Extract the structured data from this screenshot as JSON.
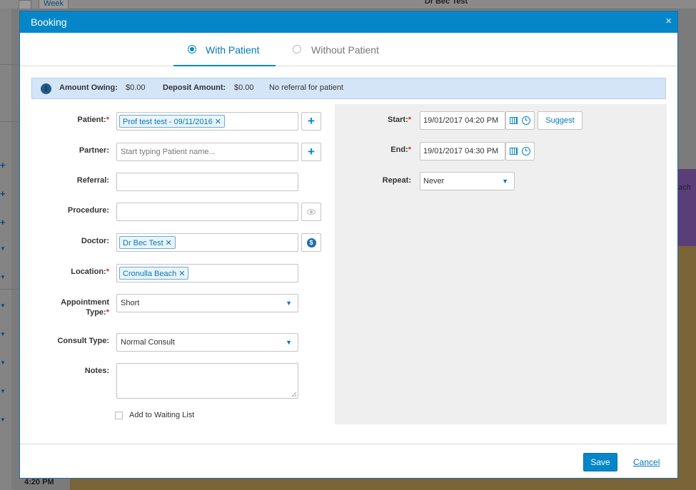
{
  "background": {
    "view_button": "Week",
    "doctor_column": "Dr Bec Test",
    "event_fragment": "ach",
    "time_label": "4:20 PM"
  },
  "modal": {
    "title": "Booking",
    "close_glyph": "×"
  },
  "tabs": {
    "with_patient": "With Patient",
    "without_patient": "Without Patient",
    "selected": "With Patient"
  },
  "alert": {
    "info_glyph": "i",
    "amount_owing_label": "Amount Owing:",
    "amount_owing_value": "$0.00",
    "deposit_label": "Deposit Amount:",
    "deposit_value": "$0.00",
    "referral_note": "No referral for patient"
  },
  "form": {
    "required_mark": "*",
    "patient_label": "Patient:",
    "patient_tag": "Prof test test - 09/11/2016",
    "partner_label": "Partner:",
    "partner_placeholder": "Start typing Patient name...",
    "referral_label": "Referral:",
    "referral_value": "",
    "procedure_label": "Procedure:",
    "procedure_value": "",
    "doctor_label": "Doctor:",
    "doctor_tag": "Dr Bec Test",
    "location_label": "Location:",
    "location_tag": "Cronulla Beach",
    "appointment_type_label_1": "Appointment",
    "appointment_type_label_2": "Type:",
    "appointment_type_value": "Short",
    "consult_type_label": "Consult Type:",
    "consult_type_value": "Normal Consult",
    "notes_label": "Notes:",
    "notes_value": "",
    "waiting_list_label": "Add to Waiting List",
    "waiting_list_checked": false,
    "remove_glyph": "✕",
    "plus_glyph": "+",
    "dollar_glyph": "$",
    "caret_glyph": "▼"
  },
  "schedule": {
    "start_label": "Start:",
    "start_value": "19/01/2017 04:20 PM",
    "end_label": "End:",
    "end_value": "19/01/2017 04:30 PM",
    "suggest_label": "Suggest",
    "repeat_label": "Repeat:",
    "repeat_value": "Never"
  },
  "footer": {
    "save_label": "Save",
    "cancel_label": "Cancel"
  },
  "colors": {
    "accent": "#0586c9",
    "alert_bg": "#d4e5f8",
    "required": "#c9302c",
    "panel_bg": "#efefef"
  }
}
